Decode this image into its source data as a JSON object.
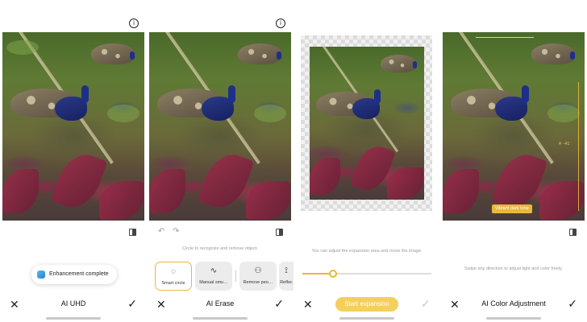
{
  "panels": [
    {
      "title": "AI UHD",
      "toast": "Enhancement complete"
    },
    {
      "title": "AI Erase",
      "hint": "Circle to recognize and remove object.",
      "tools": [
        {
          "icon": "smart-circle-icon",
          "glyph": "◌",
          "label": "Smart circle",
          "active": true
        },
        {
          "icon": "manual-smudge-icon",
          "glyph": "∿",
          "label": "Manual smu…",
          "active": false
        },
        {
          "icon": "remove-people-icon",
          "glyph": "⚇",
          "label": "Remove peo…",
          "active": false
        },
        {
          "icon": "reflection-icon",
          "glyph": "⟟",
          "label": "Reflec",
          "active": false
        }
      ]
    },
    {
      "hint": "You can adjust the expansion area and move the image.",
      "slider_value": 0.24,
      "button": "Start expansion"
    },
    {
      "title": "AI Color Adjustment",
      "badge": "Vibrant dark tone",
      "value": "-41",
      "hint": "Swipe any direction to adjust light and color freely."
    }
  ],
  "colors": {
    "accent": "#e9b83a",
    "button": "#f4cf5c"
  }
}
